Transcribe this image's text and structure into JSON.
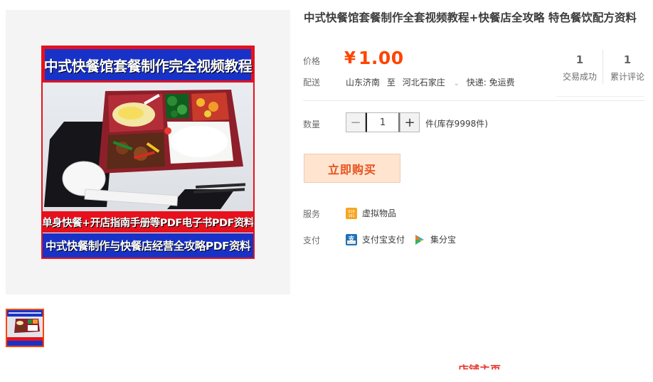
{
  "product": {
    "title": "中式快餐馆套餐制作全套视频教程+快餐店全攻略 特色餐饮配方资料",
    "main_image": {
      "top_banner": "中式快餐馆套餐制作完全视频教程",
      "middle_banner": "单身快餐+开店指南手册等PDF电子书PDF资料",
      "bottom_banner": "中式快餐制作与快餐店经营全攻略PDF资料"
    }
  },
  "price": {
    "label": "价格",
    "symbol": "¥",
    "value": "1.00"
  },
  "stats": [
    {
      "value": "1",
      "label": "交易成功"
    },
    {
      "value": "1",
      "label": "累计评论"
    }
  ],
  "delivery": {
    "label": "配送",
    "from": "山东济南",
    "to_prefix": "至",
    "to": "河北石家庄",
    "method": "快递: 免运费"
  },
  "quantity": {
    "label": "数量",
    "minus": "−",
    "value": "1",
    "plus": "+",
    "stock": "件(库存9998件)"
  },
  "buy_button": "立即购买",
  "service": {
    "label": "服务",
    "item": "虚拟物品"
  },
  "payment": {
    "label": "支付",
    "methods": [
      "支付宝支付",
      "集分宝"
    ]
  },
  "cutoff_text": {
    "left": "",
    "right": "店铺主页"
  },
  "colors": {
    "price": "#ff4400",
    "buy_bg": "#ffe4d0",
    "buy_text": "#e5511d",
    "poster_blue": "#1832c8",
    "poster_red": "#e6111c"
  }
}
